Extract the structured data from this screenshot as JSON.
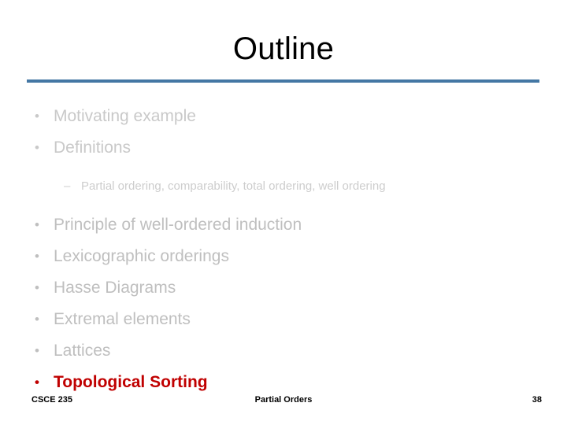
{
  "slide": {
    "title": "Outline",
    "rule_color": "#4477A4",
    "background": "#FFFFFF"
  },
  "colors": {
    "title": "#000000",
    "rule": "#4477A4",
    "dim_a": "#C9C9C9",
    "dim_b": "#BFBFBF",
    "sub_dim": "#CDCDCD",
    "active": "#C00000",
    "footer": "#000000"
  },
  "outline": {
    "items": [
      {
        "level": 1,
        "marker": "•",
        "label": "Motivating example",
        "state": "dim-a"
      },
      {
        "level": 1,
        "marker": "•",
        "label": "Definitions",
        "state": "dim-a"
      },
      {
        "level": 2,
        "marker": "–",
        "label": "Partial ordering, comparability, total ordering, well ordering",
        "state": "sub"
      },
      {
        "level": 1,
        "marker": "•",
        "label": "Principle of well-ordered induction",
        "state": "dim-b"
      },
      {
        "level": 1,
        "marker": "•",
        "label": "Lexicographic orderings",
        "state": "dim-b"
      },
      {
        "level": 1,
        "marker": "•",
        "label": "Hasse Diagrams",
        "state": "dim-b"
      },
      {
        "level": 1,
        "marker": "•",
        "label": "Extremal elements",
        "state": "dim-b"
      },
      {
        "level": 1,
        "marker": "•",
        "label": "Lattices",
        "state": "dim-b"
      },
      {
        "level": 1,
        "marker": "•",
        "label": "Topological Sorting",
        "state": "active"
      }
    ]
  },
  "footer": {
    "left": "CSCE 235",
    "center": "Partial Orders",
    "right": "38"
  }
}
